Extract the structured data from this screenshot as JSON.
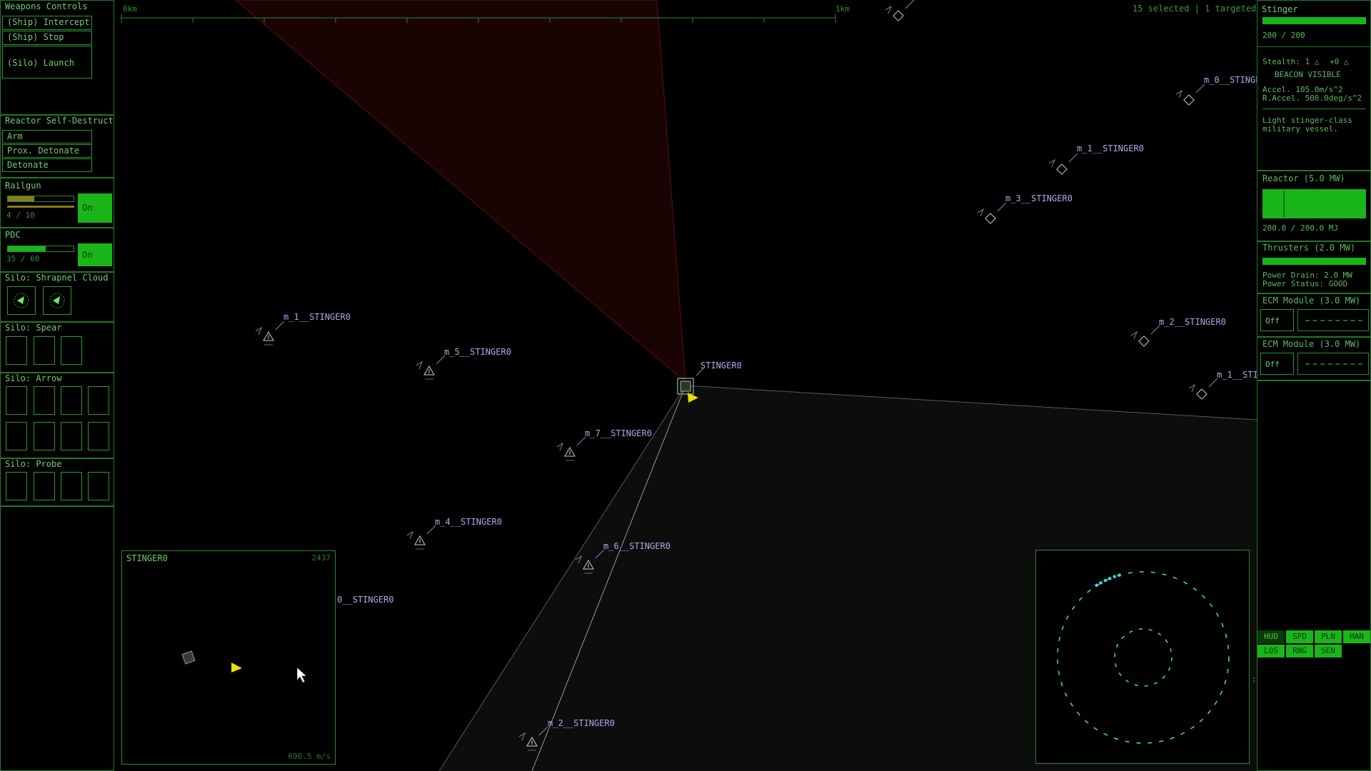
{
  "left_panel": {
    "weapons_title": "Weapons Controls",
    "ship_intercept": "(Ship) Intercept",
    "ship_stop": "(Ship) Stop",
    "silo_launch": "(Silo) Launch",
    "reactor_title": "Reactor Self-Destruct",
    "arm": "Arm",
    "prox_detonate": "Prox. Detonate",
    "detonate": "Detonate",
    "railgun_title": "Railgun",
    "railgun_ammo": "4 / 10",
    "railgun_fill": 0.4,
    "railgun_toggle": "On",
    "pdc_title": "PDC",
    "pdc_ammo": "35 / 60",
    "pdc_fill": 0.58,
    "pdc_toggle": "On",
    "silo_shrapnel": "Silo: Shrapnel Cloud",
    "silo_spear": "Silo: Spear",
    "silo_arrow": "Silo: Arrow",
    "silo_probe": "Silo: Probe"
  },
  "top": {
    "ruler_start": "0km",
    "ruler_end": "1km",
    "selection_status": "15 selected | 1 targeted"
  },
  "map_labels": {
    "player": "STINGER0",
    "m0_top": "m_0__STINGE",
    "m1_top": "m_1__STINGER0",
    "m3": "m_3__STINGER0",
    "m1_left": "m_1__STINGER0",
    "m5": "m_5__STINGER0",
    "m7": "m_7__STINGER0",
    "m4": "m_4__STINGER0",
    "m6": "m_6__STINGER0",
    "m0_left": "0__STINGER0",
    "m2_right": "m_2__STINGER0",
    "m1_right": "m_1__STI",
    "m2_bottom": "m_2__STINGER0"
  },
  "minimap": {
    "title": "STINGER0",
    "number": "2437",
    "speed": "696.5 m/s"
  },
  "right_panel": {
    "ship_name": "Stinger",
    "hull": "200 / 200",
    "hull_fill": 1.0,
    "stealth": "Stealth: 1",
    "stealth_bonus": "+0",
    "beacon": "BEACON VISIBLE",
    "accel": "Accel. 105.0m/s^2",
    "raccel": "R.Accel. 500.0deg/s^2",
    "description": "Light stinger-class military vessel.",
    "reactor_title": "Reactor  (5.0 MW)",
    "reactor_value": "200.0 / 200.0 MJ",
    "reactor_fill": 1.0,
    "thrusters_title": "Thrusters  (2.0 MW)",
    "thrusters_fill": 1.0,
    "power_drain": "Power Drain: 2.0 MW",
    "power_status": "Power Status: GOOD",
    "ecm1_title": "ECM Module  (3.0 MW)",
    "ecm1_toggle": "Off",
    "ecm2_title": "ECM Module  (3.0 MW)",
    "ecm2_toggle": "Off",
    "tabs": [
      {
        "label": "HUD",
        "active": false
      },
      {
        "label": "SPD",
        "active": true
      },
      {
        "label": "PLN",
        "active": true
      },
      {
        "label": "MAN",
        "active": true
      },
      {
        "label": "LOS",
        "active": true
      },
      {
        "label": "RNG",
        "active": true
      },
      {
        "label": "SEN",
        "active": true
      }
    ]
  },
  "colors": {
    "panel_green": "#1f7a1f",
    "accent_green": "#19b519",
    "label_blue": "#a9a9e8",
    "player_yellow": "#e8e000",
    "cyan": "#3fd8e0"
  },
  "icons": {
    "ship_marker": "triangle-ship-icon",
    "player_arrow": "yellow-arrow-icon",
    "shrapnel": "shrapnel-burst-icon",
    "stealth": "radiation-icon",
    "cursor": "mouse-cursor-icon"
  }
}
